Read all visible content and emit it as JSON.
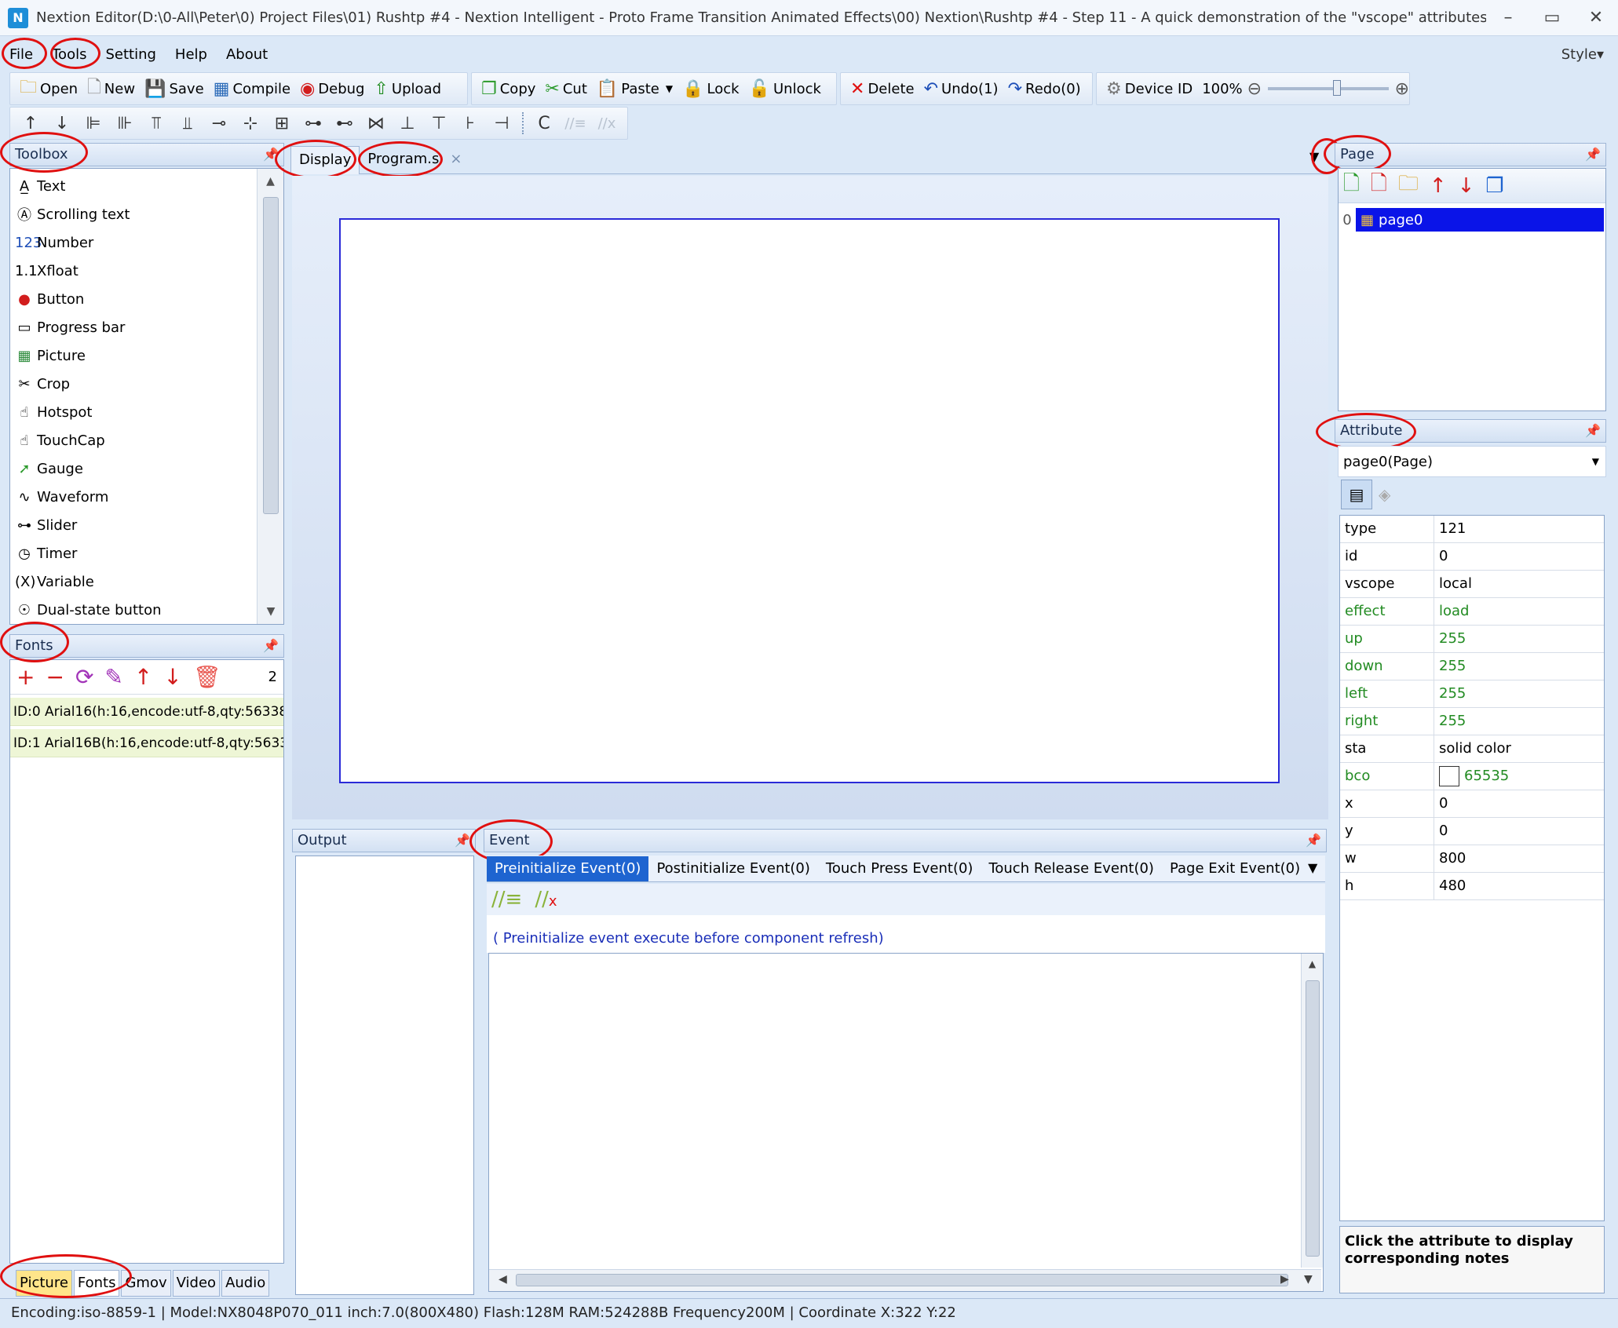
{
  "window": {
    "title": "Nextion Editor(D:\\0-All\\Peter\\0) Project Files\\01) Rushtp #4 - Nextion Intelligent - Proto Frame Transition Animated Effects\\00) Nextion\\Rushtp #4 - Step 11 - A quick demonstration of the \"vscope\" attributes \"Local\" and \"Global\".H...",
    "app_icon": "N",
    "minimize": "–",
    "maximize": "▭",
    "close": "✕"
  },
  "menu": {
    "file": "File",
    "tools": "Tools",
    "setting": "Setting",
    "help": "Help",
    "about": "About",
    "style": "Style▾"
  },
  "toolbar": {
    "open": "Open",
    "new": "New",
    "save": "Save",
    "compile": "Compile",
    "debug": "Debug",
    "upload": "Upload",
    "copy": "Copy",
    "cut": "Cut",
    "paste": "Paste",
    "lock": "Lock",
    "unlock": "Unlock",
    "delete": "Delete",
    "undo": "Undo(1)",
    "redo": "Redo(0)",
    "device_id": "Device ID",
    "zoom": "100%",
    "zoom_level": 0.55
  },
  "align_toolbar": {
    "icons": [
      "↑",
      "↓",
      "⊫",
      "⊪",
      "⫪",
      "⫫",
      "⊸",
      "⊹",
      "⊞",
      "⊶",
      "⊷",
      "⋈",
      "⊥",
      "⊤",
      "⊦",
      "⊣",
      "C"
    ]
  },
  "toolbox": {
    "title": "Toolbox",
    "items": [
      {
        "icon": "A̲",
        "label": "Text"
      },
      {
        "icon": "Ⓐ",
        "label": "Scrolling text"
      },
      {
        "icon": "123",
        "label": "Number"
      },
      {
        "icon": "1.1",
        "label": "Xfloat"
      },
      {
        "icon": "●",
        "label": "Button"
      },
      {
        "icon": "▭",
        "label": "Progress bar"
      },
      {
        "icon": "▦",
        "label": "Picture"
      },
      {
        "icon": "✂",
        "label": "Crop"
      },
      {
        "icon": "☝",
        "label": "Hotspot"
      },
      {
        "icon": "☝",
        "label": "TouchCap"
      },
      {
        "icon": "➚",
        "label": "Gauge"
      },
      {
        "icon": "∿",
        "label": "Waveform"
      },
      {
        "icon": "⊶",
        "label": "Slider"
      },
      {
        "icon": "◷",
        "label": "Timer"
      },
      {
        "icon": "(X)",
        "label": "Variable"
      },
      {
        "icon": "☉",
        "label": "Dual-state button"
      }
    ]
  },
  "fonts": {
    "title": "Fonts",
    "count": "2",
    "items": [
      "ID:0  Arial16(h:16,encode:utf-8,qty:56338",
      "ID:1  Arial16B(h:16,encode:utf-8,qty:5633"
    ]
  },
  "bottom_tabs": [
    "Picture",
    "Fonts",
    "Gmov",
    "Video",
    "Audio"
  ],
  "editor_tabs": {
    "display": "Display",
    "program": "Program.s",
    "close": "×"
  },
  "output": {
    "title": "Output"
  },
  "event": {
    "title": "Event",
    "tabs": [
      "Preinitialize Event(0)",
      "Postinitialize Event(0)",
      "Touch Press Event(0)",
      "Touch Release Event(0)",
      "Page Exit Event(0)"
    ],
    "hint": "( Preinitialize event execute before component refresh)"
  },
  "page_panel": {
    "title": "Page",
    "index": "0",
    "page_name": "page0"
  },
  "attribute": {
    "title": "Attribute",
    "selector": "page0(Page)",
    "rows": [
      {
        "key": "type",
        "value": "121",
        "green": false
      },
      {
        "key": "id",
        "value": "0",
        "green": false
      },
      {
        "key": "vscope",
        "value": "local",
        "green": false
      },
      {
        "key": "effect",
        "value": "load",
        "green": true
      },
      {
        "key": "up",
        "value": "255",
        "green": true
      },
      {
        "key": "down",
        "value": "255",
        "green": true
      },
      {
        "key": "left",
        "value": "255",
        "green": true
      },
      {
        "key": "right",
        "value": "255",
        "green": true
      },
      {
        "key": "sta",
        "value": "solid color",
        "green": false
      },
      {
        "key": "bco",
        "value": "65535",
        "green": true
      },
      {
        "key": "x",
        "value": "0",
        "green": false
      },
      {
        "key": "y",
        "value": "0",
        "green": false
      },
      {
        "key": "w",
        "value": "800",
        "green": false
      },
      {
        "key": "h",
        "value": "480",
        "green": false
      }
    ],
    "note": "Click the attribute to display corresponding notes"
  },
  "status": {
    "text": "Encoding:iso-8859-1 | Model:NX8048P070_011 inch:7.0(800X480) Flash:128M RAM:524288B Frequency200M |   Coordinate X:322  Y:22"
  },
  "colors": {
    "accent": "#1e64d0",
    "highlight": "#e01010",
    "selected_page": "#0a14e8",
    "attr_green": "#228b22"
  }
}
